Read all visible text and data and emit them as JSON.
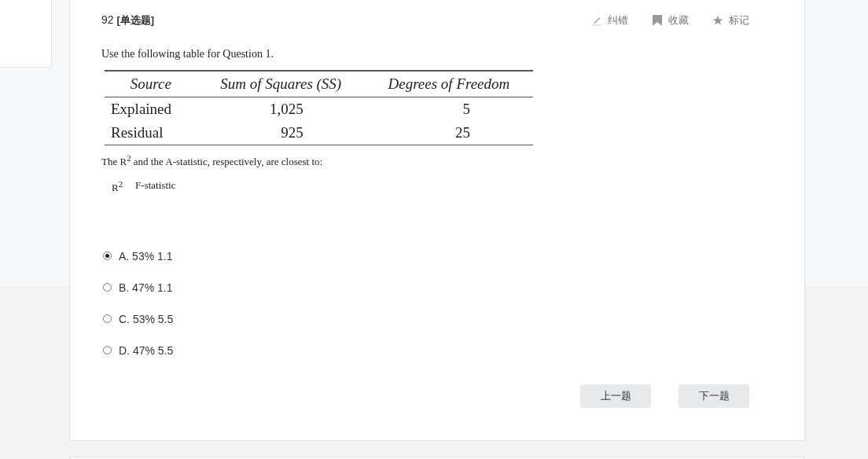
{
  "question": {
    "number": "92",
    "type": "[单选题]"
  },
  "actions": [
    {
      "kind": "pencil",
      "label": "纠错"
    },
    {
      "kind": "bookmark",
      "label": "收藏"
    },
    {
      "kind": "star",
      "label": "标记"
    }
  ],
  "intro": "Use the following table for Question 1.",
  "table": {
    "columns": [
      "Source",
      "Sum of Squares (SS)",
      "Degrees of Freedom"
    ],
    "rows": [
      [
        "Explained",
        "1,025",
        "5"
      ],
      [
        "Residual",
        "925",
        "25"
      ]
    ]
  },
  "prompt": "The R$^{2}$ and the A-statistic, respectively, are closest to:",
  "answer_headers": [
    "R$^{2}$",
    "F-statistic"
  ],
  "options": [
    {
      "label": "A. 53% 1.1",
      "selected": true
    },
    {
      "label": "B. 47% 1.1",
      "selected": false
    },
    {
      "label": "C. 53% 5.5",
      "selected": false
    },
    {
      "label": "D. 47% 5.5",
      "selected": false
    }
  ],
  "buttons": [
    "上一题",
    "下一题"
  ]
}
